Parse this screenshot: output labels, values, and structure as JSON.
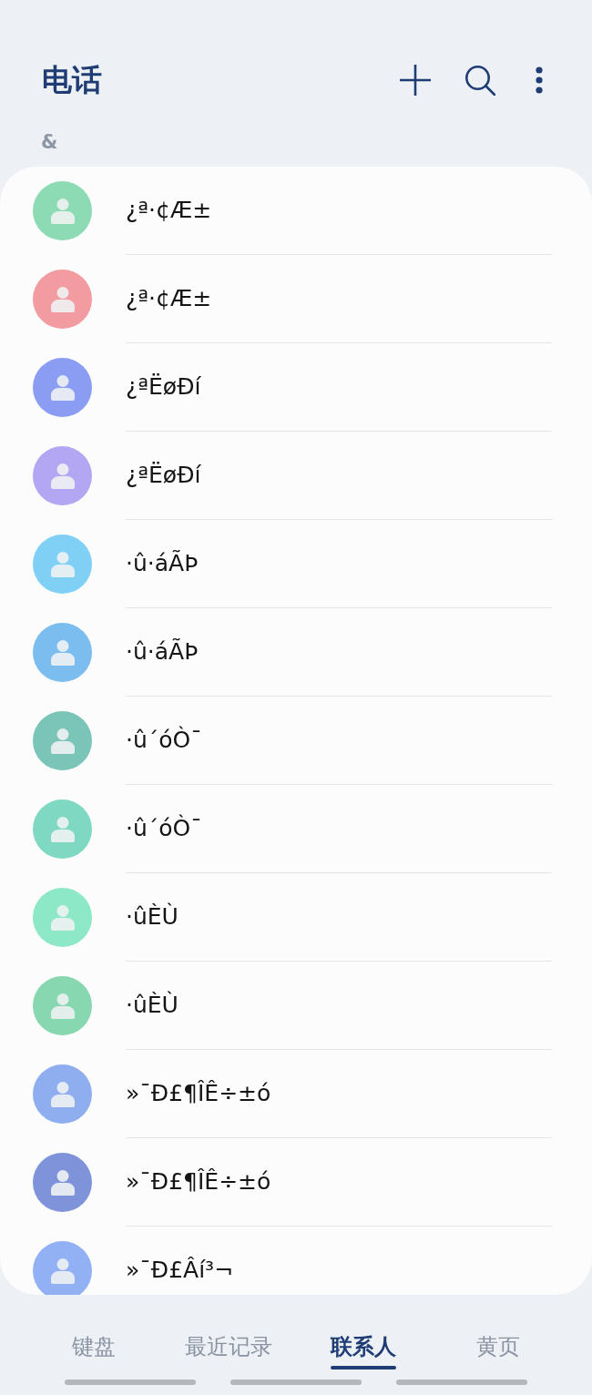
{
  "header": {
    "title": "电话"
  },
  "section": {
    "letter": "&"
  },
  "contacts": [
    {
      "name": "¿ª·¢Æ±",
      "color": "#8ddbb5"
    },
    {
      "name": "¿ª·¢Æ±",
      "color": "#f29ba0"
    },
    {
      "name": "¿ªËøÐí",
      "color": "#8b9df3"
    },
    {
      "name": "¿ªËøÐí",
      "color": "#b3a7f4"
    },
    {
      "name": "·û·áÃÞ",
      "color": "#80d0f6"
    },
    {
      "name": "·û·áÃÞ",
      "color": "#7cbdf0"
    },
    {
      "name": "·û´óÒ¯",
      "color": "#7bc4b8"
    },
    {
      "name": "·û´óÒ¯",
      "color": "#7fd9c2"
    },
    {
      "name": "·ûÈÙ",
      "color": "#8de8c8"
    },
    {
      "name": "·ûÈÙ",
      "color": "#87d7b0"
    },
    {
      "name": "»¯Ð£¶ÎÊ÷±ó",
      "color": "#8eaeef"
    },
    {
      "name": "»¯Ð£¶ÎÊ÷±ó",
      "color": "#7e93d9"
    },
    {
      "name": "»¯Ð£Âí³¬",
      "color": "#92b0f4"
    }
  ],
  "tabs": [
    {
      "label": "键盘",
      "selected": false
    },
    {
      "label": "最近记录",
      "selected": false
    },
    {
      "label": "联系人",
      "selected": true
    },
    {
      "label": "黄页",
      "selected": false
    }
  ]
}
